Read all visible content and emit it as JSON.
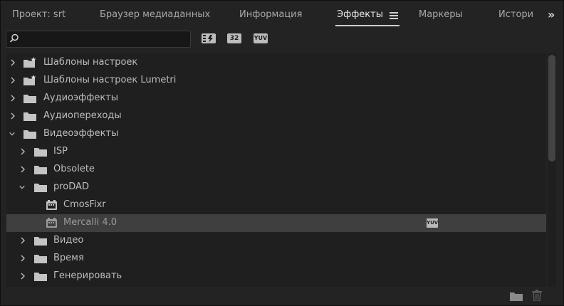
{
  "tabs": [
    {
      "label": "Проект: srt",
      "active": false
    },
    {
      "label": "Браузер медиаданных",
      "active": false
    },
    {
      "label": "Информация",
      "active": false
    },
    {
      "label": "Эффекты",
      "active": true
    },
    {
      "label": "Маркеры",
      "active": false
    },
    {
      "label": "Истори",
      "active": false
    }
  ],
  "overflow_label": "»",
  "toolbar": {
    "search_value": "",
    "accel_badge": "32",
    "yuv_badge": "YUV"
  },
  "tree": [
    {
      "label": "Шаблоны настроек",
      "type": "preset-folder",
      "expanded": false
    },
    {
      "label": "Шаблоны настроек Lumetri",
      "type": "preset-folder",
      "expanded": false
    },
    {
      "label": "Аудиоэффекты",
      "type": "folder",
      "expanded": false
    },
    {
      "label": "Аудиопереходы",
      "type": "folder",
      "expanded": false
    },
    {
      "label": "Видеоэффекты",
      "type": "folder",
      "expanded": true
    },
    {
      "label": "ISP",
      "type": "folder",
      "expanded": false
    },
    {
      "label": "Obsolete",
      "type": "folder",
      "expanded": false
    },
    {
      "label": "proDAD",
      "type": "folder",
      "expanded": true
    },
    {
      "label": "CmosFixr",
      "type": "effect"
    },
    {
      "label": "Mercalli 4.0",
      "type": "effect",
      "selected": true,
      "badge": "YUV"
    },
    {
      "label": "Видео",
      "type": "folder",
      "expanded": false
    },
    {
      "label": "Время",
      "type": "folder",
      "expanded": false
    },
    {
      "label": "Генерировать",
      "type": "folder",
      "expanded": false
    }
  ],
  "colors": {
    "panel_bg": "#232323",
    "list_bg": "#1f1f1f",
    "selected_row": "#3f3f3f",
    "text": "#bdbdbd"
  }
}
